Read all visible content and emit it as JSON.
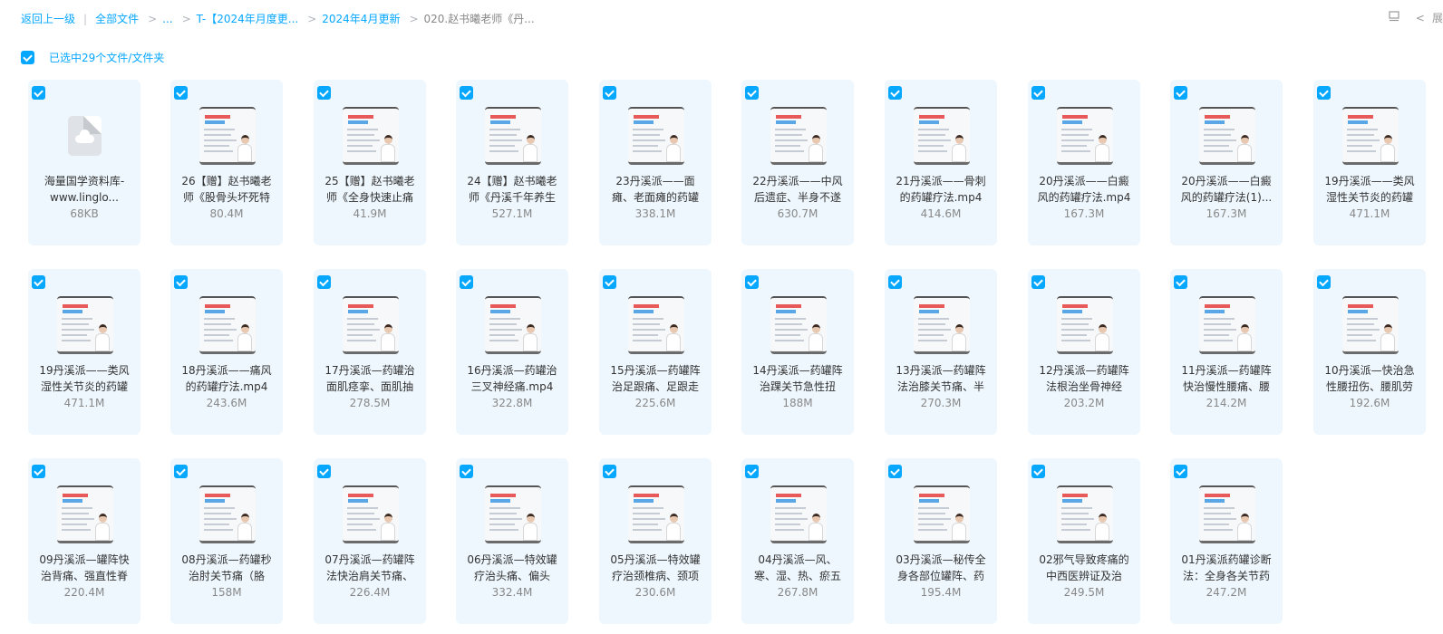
{
  "breadcrumb": {
    "back_label": "返回上一级",
    "separator": "|",
    "all_files_label": "全部文件",
    "ellipsis": "...",
    "arrow": ">",
    "items": [
      "T-【2024年月度更...",
      "2024年4月更新"
    ],
    "current": "020.赵书曦老师《丹..."
  },
  "toolbar": {
    "view_icon": "list-view-icon",
    "collapse_glyph": "<",
    "expand_label": "展"
  },
  "selection": {
    "label": "已选中29个文件/文件夹",
    "all_checked": true
  },
  "accent_color": "#06a7ff",
  "files": [
    {
      "name": "海量国学资料库-www.linglo...",
      "size": "68KB",
      "type": "file"
    },
    {
      "name": "26【赠】赵书曦老师《股骨头坏死特",
      "size": "80.4M",
      "type": "video"
    },
    {
      "name": "25【赠】赵书曦老师《全身快速止痛",
      "size": "41.9M",
      "type": "video"
    },
    {
      "name": "24【赠】赵书曦老师《丹溪千年养生",
      "size": "527.1M",
      "type": "video"
    },
    {
      "name": "23丹溪派——面瘫、老面瘫的药罐",
      "size": "338.1M",
      "type": "video"
    },
    {
      "name": "22丹溪派——中风后遗症、半身不遂",
      "size": "630.7M",
      "type": "video"
    },
    {
      "name": "21丹溪派——骨刺的药罐疗法.mp4",
      "size": "414.6M",
      "type": "video"
    },
    {
      "name": "20丹溪派——白癜风的药罐疗法.mp4",
      "size": "167.3M",
      "type": "video"
    },
    {
      "name": "20丹溪派——白癜风的药罐疗法(1)...",
      "size": "167.3M",
      "type": "video"
    },
    {
      "name": "19丹溪派——类风湿性关节炎的药罐",
      "size": "471.1M",
      "type": "video"
    },
    {
      "name": "19丹溪派——类风湿性关节炎的药罐",
      "size": "471.1M",
      "type": "video"
    },
    {
      "name": "18丹溪派——痛风的药罐疗法.mp4",
      "size": "243.6M",
      "type": "video"
    },
    {
      "name": "17丹溪派—药罐治面肌痉挛、面肌抽",
      "size": "278.5M",
      "type": "video"
    },
    {
      "name": "16丹溪派—药罐治三叉神经痛.mp4",
      "size": "322.8M",
      "type": "video"
    },
    {
      "name": "15丹溪派—药罐阵治足跟痛、足跟走",
      "size": "225.6M",
      "type": "video"
    },
    {
      "name": "14丹溪派—药罐阵治踝关节急性扭",
      "size": "188M",
      "type": "video"
    },
    {
      "name": "13丹溪派—药罐阵法治膝关节痛、半",
      "size": "270.3M",
      "type": "video"
    },
    {
      "name": "12丹溪派—药罐阵法根治坐骨神经",
      "size": "203.2M",
      "type": "video"
    },
    {
      "name": "11丹溪派—药罐阵快治慢性腰痛、腰",
      "size": "214.2M",
      "type": "video"
    },
    {
      "name": "10丹溪派—快治急性腰扭伤、腰肌劳",
      "size": "192.6M",
      "type": "video"
    },
    {
      "name": "09丹溪派—罐阵快治背痛、强直性脊",
      "size": "220.4M",
      "type": "video"
    },
    {
      "name": "08丹溪派—药罐秒治肘关节痛（胳",
      "size": "158M",
      "type": "video"
    },
    {
      "name": "07丹溪派—药罐阵法快治肩关节痛、",
      "size": "226.4M",
      "type": "video"
    },
    {
      "name": "06丹溪派—特效罐疗治头痛、偏头",
      "size": "332.4M",
      "type": "video"
    },
    {
      "name": "05丹溪派—特效罐疗治颈椎病、颈项",
      "size": "230.6M",
      "type": "video"
    },
    {
      "name": "04丹溪派—风、寒、湿、热、瘀五",
      "size": "267.8M",
      "type": "video"
    },
    {
      "name": "03丹溪派—秘传全身各部位罐阵、药",
      "size": "195.4M",
      "type": "video"
    },
    {
      "name": "02邪气导致疼痛的中西医辨证及治",
      "size": "249.5M",
      "type": "video"
    },
    {
      "name": "01丹溪派药罐诊断法：全身各关节药",
      "size": "247.2M",
      "type": "video"
    }
  ]
}
